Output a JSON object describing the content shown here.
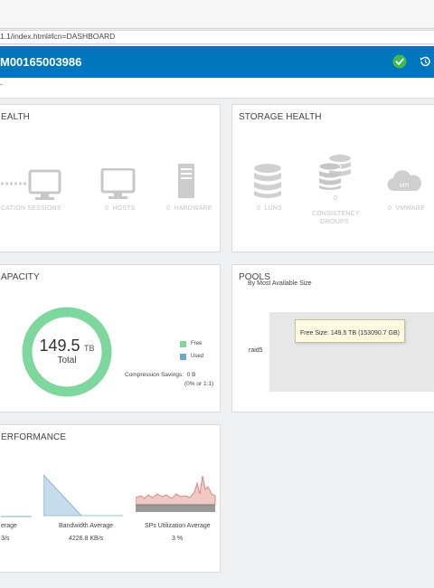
{
  "browser": {
    "url": "1.1/index.html#lcn=DASHBOARD"
  },
  "header": {
    "system_name": "M00165003986",
    "status_icon": "check-circle-icon",
    "history_icon": "history-icon"
  },
  "subbar": {
    "text": "-"
  },
  "system_health": {
    "title": "EALTH",
    "items": [
      {
        "label": "CATION SESSIONS",
        "icon": "monitor-icon"
      },
      {
        "count": "0",
        "label": "HOSTS",
        "icon": "monitor-icon"
      },
      {
        "count": "0",
        "label": "HARDWARE",
        "icon": "server-tower-icon"
      }
    ]
  },
  "storage_health": {
    "title": "STORAGE HEALTH",
    "items": [
      {
        "count": "0",
        "label": "LUNS",
        "icon": "database-icon"
      },
      {
        "count": "0",
        "label": "CONSISTENCY GROUPS",
        "label_line1": "CONSISTENCY",
        "label_line2": "GROUPS",
        "icon": "stacked-database-icon"
      },
      {
        "count": "0",
        "label": "VMWARE",
        "icon": "vm-cloud-icon"
      }
    ]
  },
  "capacity": {
    "title": "APACITY",
    "total_value": "149.5",
    "total_unit": "TB",
    "total_label": "Total",
    "free_fraction": 0.999,
    "legend": [
      {
        "label": "Free",
        "color": "#7ed89e"
      },
      {
        "label": "Used",
        "color": "#6ea6cf"
      }
    ],
    "compression_label": "Compression Savings:",
    "compression_value": "0 B",
    "compression_ratio": "(0% or 1:1)"
  },
  "pools": {
    "title": "POOLS",
    "subtitle": "By Most Available Size",
    "pool_name": "raid5",
    "tooltip": "Free Size: 149.5 TB (153090.7 GB)"
  },
  "performance": {
    "title": "ERFORMANCE",
    "metrics": [
      {
        "label": "erage",
        "value": "3/s"
      },
      {
        "label": "Bandwidth Average",
        "value": "4226.8 KB/s"
      },
      {
        "label": "SPs Utilization Average",
        "value": "3 %"
      }
    ]
  }
}
